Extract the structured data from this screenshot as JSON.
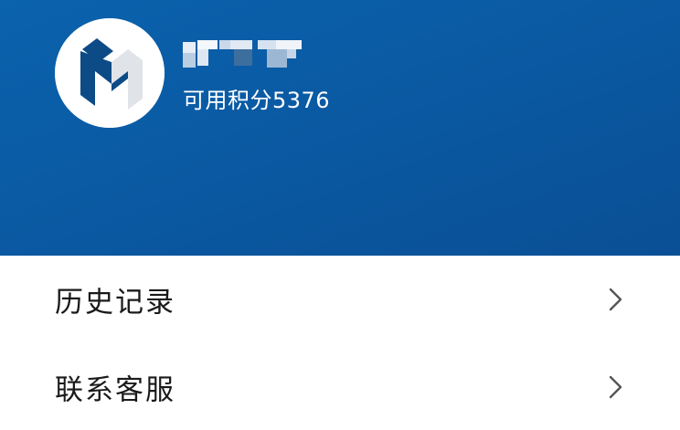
{
  "profile": {
    "points_label": "可用积分5376",
    "username_icon": "pixelated-username"
  },
  "menu": {
    "items": [
      {
        "label": "历史记录",
        "icon": "chevron-right-icon"
      },
      {
        "label": "联系客服",
        "icon": "chevron-right-icon"
      }
    ]
  },
  "colors": {
    "header_blue": "#0a5aa3",
    "logo_dark_blue": "#0d4b86",
    "text_dark": "#1a1a1a",
    "chevron_gray": "#555555"
  }
}
